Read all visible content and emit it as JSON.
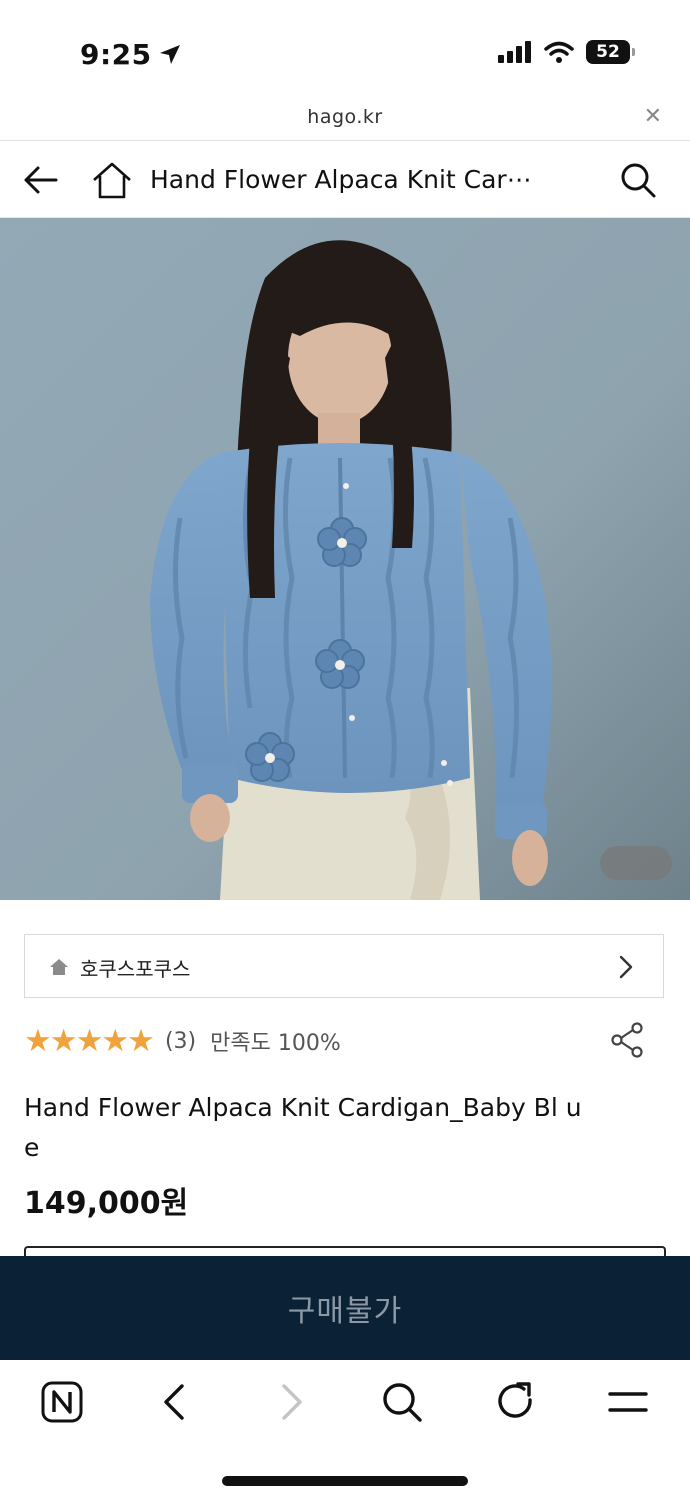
{
  "status_bar": {
    "time": "9:25",
    "battery": "52"
  },
  "url_bar": {
    "domain": "hago.kr",
    "close_icon": "close-icon"
  },
  "header": {
    "title": "Hand Flower Alpaca Knit Car⋯"
  },
  "store": {
    "name": "호쿠스포쿠스"
  },
  "rating": {
    "stars": "★★★★★",
    "star_value": 5,
    "count": "(3)",
    "satisfaction": "만족도 100%",
    "star_color": "#f0a23c"
  },
  "product": {
    "name": "Hand Flower Alpaca Knit Cardigan_Baby Bl ue",
    "price": "149,000원"
  },
  "buy_button": {
    "label": "구매불가",
    "background": "#0b2236"
  },
  "toolbar": {
    "items": [
      "naver-n-icon",
      "back-arrow-icon",
      "forward-arrow-icon",
      "search-icon",
      "reload-icon",
      "menu-icon"
    ]
  }
}
